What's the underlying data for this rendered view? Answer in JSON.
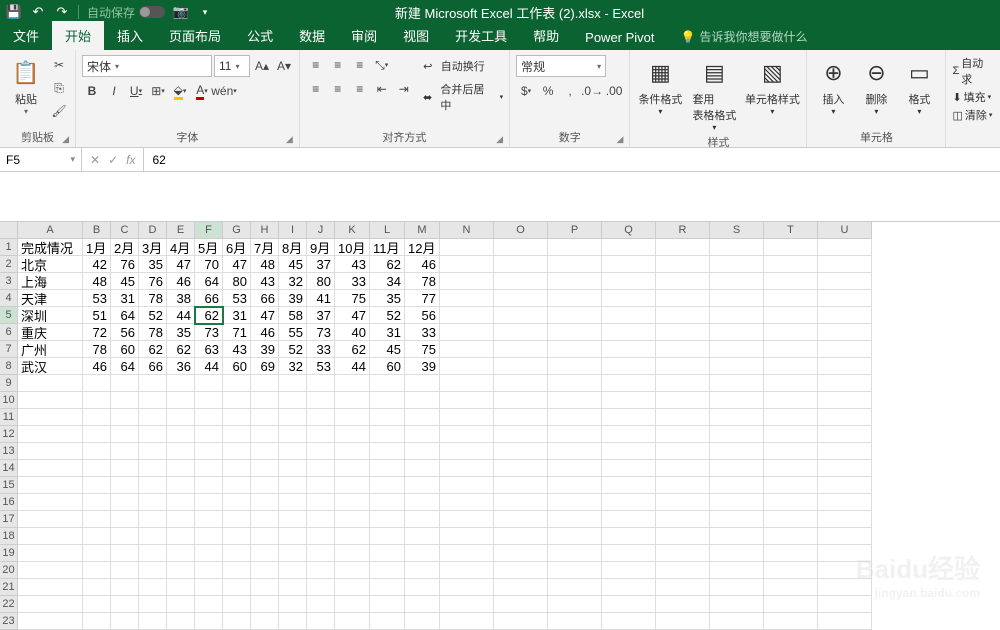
{
  "title": "新建 Microsoft Excel 工作表 (2).xlsx - Excel",
  "qat": {
    "autosave_label": "自动保存"
  },
  "tabs": [
    "文件",
    "开始",
    "插入",
    "页面布局",
    "公式",
    "数据",
    "审阅",
    "视图",
    "开发工具",
    "帮助",
    "Power Pivot"
  ],
  "active_tab_index": 1,
  "tell_me": "告诉我你想要做什么",
  "ribbon": {
    "clipboard": {
      "paste": "粘贴",
      "label": "剪贴板"
    },
    "font": {
      "name": "宋体",
      "size": "11",
      "label": "字体",
      "bold": "B",
      "italic": "I",
      "underline": "U"
    },
    "alignment": {
      "wrap": "自动换行",
      "merge": "合并后居中",
      "label": "对齐方式"
    },
    "number": {
      "format": "常规",
      "label": "数字"
    },
    "styles": {
      "cond": "条件格式",
      "table": "套用\n表格格式",
      "cell": "单元格样式",
      "label": "样式"
    },
    "cells": {
      "insert": "插入",
      "delete": "删除",
      "format": "格式",
      "label": "单元格"
    },
    "editing": {
      "sum": "自动求",
      "fill": "填充",
      "clear": "清除"
    }
  },
  "namebox": "F5",
  "formula_value": "62",
  "colWidths": {
    "A": 65,
    "narrow": 28,
    "wide10": 35,
    "rest": 54
  },
  "cols": [
    "A",
    "B",
    "C",
    "D",
    "E",
    "F",
    "G",
    "H",
    "I",
    "J",
    "K",
    "L",
    "M",
    "N",
    "O",
    "P",
    "Q",
    "R",
    "S",
    "T",
    "U"
  ],
  "selected_col_index": 5,
  "selected_row_index": 4,
  "headers": [
    "完成情况",
    "1月",
    "2月",
    "3月",
    "4月",
    "5月",
    "6月",
    "7月",
    "8月",
    "9月",
    "10月",
    "11月",
    "12月"
  ],
  "chart_data": {
    "type": "table",
    "title": "完成情况",
    "columns": [
      "1月",
      "2月",
      "3月",
      "4月",
      "5月",
      "6月",
      "7月",
      "8月",
      "9月",
      "10月",
      "11月",
      "12月"
    ],
    "rows": [
      {
        "name": "北京",
        "values": [
          42,
          76,
          35,
          47,
          70,
          47,
          48,
          45,
          37,
          43,
          62,
          46
        ]
      },
      {
        "name": "上海",
        "values": [
          48,
          45,
          76,
          46,
          64,
          80,
          43,
          32,
          80,
          33,
          34,
          78
        ]
      },
      {
        "name": "天津",
        "values": [
          53,
          31,
          78,
          38,
          66,
          53,
          66,
          39,
          41,
          75,
          35,
          77
        ]
      },
      {
        "name": "深圳",
        "values": [
          51,
          64,
          52,
          44,
          62,
          31,
          47,
          58,
          37,
          47,
          52,
          56
        ]
      },
      {
        "name": "重庆",
        "values": [
          72,
          56,
          78,
          35,
          73,
          71,
          46,
          55,
          73,
          40,
          31,
          33
        ]
      },
      {
        "name": "广州",
        "values": [
          78,
          60,
          62,
          62,
          63,
          43,
          39,
          52,
          33,
          62,
          45,
          75
        ]
      },
      {
        "name": "武汉",
        "values": [
          46,
          64,
          66,
          36,
          44,
          60,
          69,
          32,
          53,
          44,
          60,
          39
        ]
      }
    ]
  },
  "total_rows": 23,
  "watermark": {
    "main": "Baidu经验",
    "sub": "jingyan.baidu.com"
  }
}
